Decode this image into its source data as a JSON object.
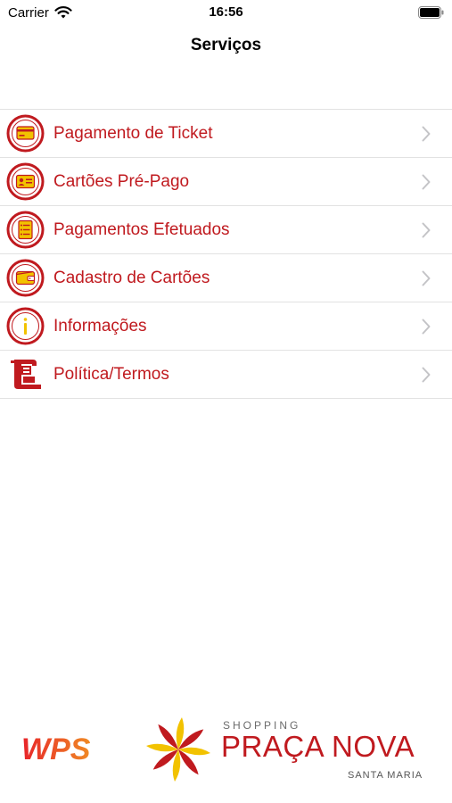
{
  "status_bar": {
    "carrier": "Carrier",
    "time": "16:56"
  },
  "nav": {
    "title": "Serviços"
  },
  "menu": [
    {
      "label": "Pagamento de Ticket",
      "icon": "ticket-payment-icon"
    },
    {
      "label": "Cartões Pré-Pago",
      "icon": "prepaid-card-icon"
    },
    {
      "label": "Pagamentos Efetuados",
      "icon": "payments-made-icon"
    },
    {
      "label": "Cadastro de Cartões",
      "icon": "card-register-icon"
    },
    {
      "label": "Informações",
      "icon": "info-icon"
    },
    {
      "label": "Política/Termos",
      "icon": "policy-scroll-icon"
    }
  ],
  "footer": {
    "wps": "WPS",
    "shopping": "SHOPPING",
    "brand": "PRAÇA NOVA",
    "city": "SANTA MARIA"
  },
  "colors": {
    "accent": "#c01a1f",
    "icon_fill": "#f2c200",
    "separator": "#e2e2e2"
  }
}
